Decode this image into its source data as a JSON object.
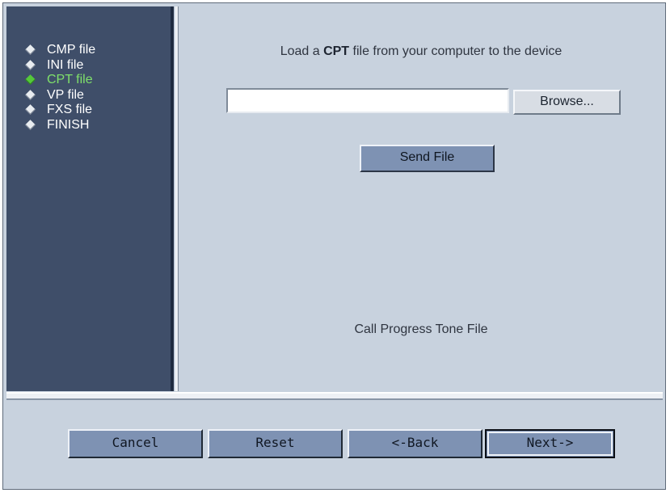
{
  "sidebar": {
    "items": [
      {
        "label": "CMP file",
        "active": false
      },
      {
        "label": "INI file",
        "active": false
      },
      {
        "label": "CPT file",
        "active": true
      },
      {
        "label": "VP file",
        "active": false
      },
      {
        "label": "FXS file",
        "active": false
      },
      {
        "label": "FINISH",
        "active": false
      }
    ]
  },
  "main": {
    "title_prefix": "Load a ",
    "title_bold": "CPT",
    "title_suffix": " file from your computer to the device",
    "file_input_value": "",
    "browse_label": "Browse...",
    "send_label": "Send File",
    "caption": "Call Progress Tone File"
  },
  "footer": {
    "cancel_label": "Cancel",
    "reset_label": "Reset",
    "back_label": "<-Back",
    "next_label": "Next->"
  },
  "colors": {
    "panel_background": "#c8d2de",
    "sidebar_background": "#3f4e69",
    "active_item": "#7fe06a",
    "button_fill": "#7e92b3"
  },
  "icons": {
    "sidebar_bullet": "diamond-bullet-icon"
  }
}
